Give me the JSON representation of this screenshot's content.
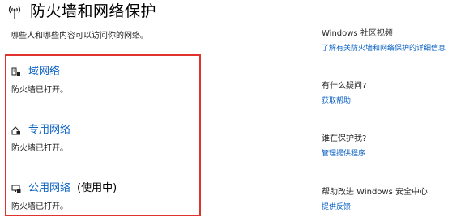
{
  "header": {
    "title": "防火墙和网络保护",
    "icon": "wireless-antenna-icon"
  },
  "subtitle": "哪些人和哪些内容可以访问你的网络。",
  "networks": [
    {
      "name": "域网络",
      "in_use": "",
      "status": "防火墙已打开。",
      "icon": "domain-network-icon"
    },
    {
      "name": "专用网络",
      "in_use": "",
      "status": "防火墙已打开。",
      "icon": "private-network-icon"
    },
    {
      "name": "公用网络",
      "in_use": "(使用中)",
      "status": "防火墙已打开。",
      "icon": "public-network-icon"
    }
  ],
  "sidebar": {
    "community": {
      "heading": "Windows 社区视频",
      "link": "了解有关防火墙和网络保护的详细信息"
    },
    "question": {
      "heading": "有什么疑问?",
      "link": "获取帮助"
    },
    "protector": {
      "heading": "谁在保护我?",
      "link": "管理提供程序"
    },
    "improve": {
      "heading": "帮助改进 Windows 安全中心",
      "link": "提供反馈"
    }
  },
  "colors": {
    "link": "#0b62c4",
    "highlight_border": "#e0332e"
  }
}
